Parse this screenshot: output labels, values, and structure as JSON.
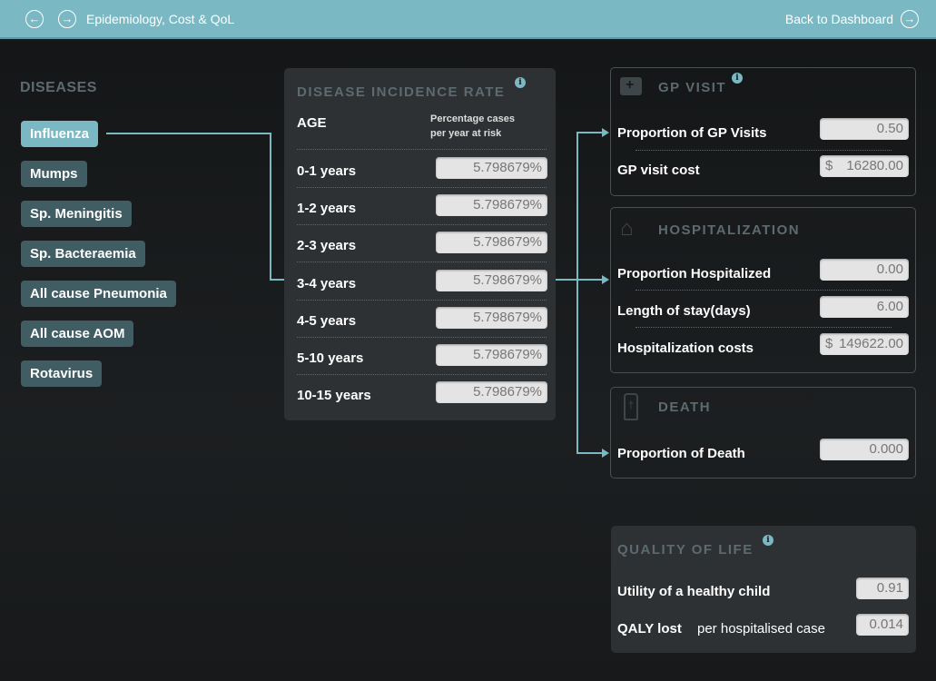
{
  "header": {
    "title": "Epidemiology, Cost & QoL",
    "back_label": "Back to Dashboard",
    "accent": "#7ab8c4"
  },
  "diseases": {
    "heading": "DISEASES",
    "items": [
      {
        "label": "Influenza",
        "active": true
      },
      {
        "label": "Mumps"
      },
      {
        "label": "Sp. Meningitis"
      },
      {
        "label": "Sp. Bacteraemia"
      },
      {
        "label": "All cause Pneumonia"
      },
      {
        "label": "All cause AOM"
      },
      {
        "label": "Rotavirus"
      }
    ]
  },
  "incidence": {
    "title": "DISEASE INCIDENCE RATE",
    "age_header": "AGE",
    "pct_header_1": "Percentage cases",
    "pct_header_2": "per year at risk",
    "rows": [
      {
        "age": "0-1 years",
        "value": "5.798679%"
      },
      {
        "age": "1-2 years",
        "value": "5.798679%"
      },
      {
        "age": "2-3 years",
        "value": "5.798679%"
      },
      {
        "age": "3-4 years",
        "value": "5.798679%"
      },
      {
        "age": "4-5 years",
        "value": "5.798679%"
      },
      {
        "age": "5-10 years",
        "value": "5.798679%"
      },
      {
        "age": "10-15 years",
        "value": "5.798679%"
      }
    ]
  },
  "gp": {
    "title": "GP VISIT",
    "prop_label": "Proportion of GP Visits",
    "prop_value": "0.50",
    "cost_label": "GP visit cost",
    "cost_currency": "$",
    "cost_value": "16280.00"
  },
  "hosp": {
    "title": "HOSPITALIZATION",
    "prop_label": "Proportion Hospitalized",
    "prop_value": "0.00",
    "stay_label": "Length of stay(days)",
    "stay_value": "6.00",
    "cost_label": "Hospitalization costs",
    "cost_currency": "$",
    "cost_value": "149622.00"
  },
  "death": {
    "title": "DEATH",
    "prop_label": "Proportion of Death",
    "prop_value": "0.000"
  },
  "qol": {
    "title": "QUALITY OF LIFE",
    "utility_label": "Utility of a healthy child",
    "utility_value": "0.91",
    "qaly_label": "QALY lost",
    "qaly_sub": "per hospitalised case",
    "qaly_value": "0.014"
  }
}
